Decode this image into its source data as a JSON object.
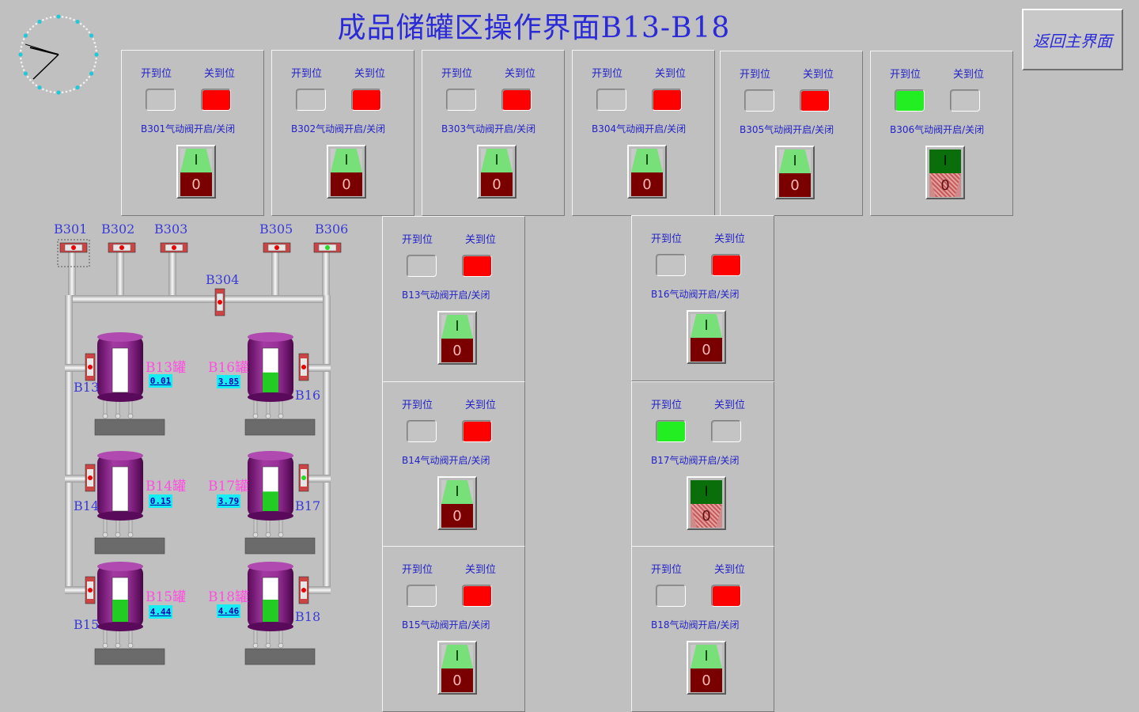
{
  "title": "成品储罐区操作界面B13-B18",
  "home_button": "返回主界面",
  "label_open": "开到位",
  "label_close": "关到位",
  "switch_on_glyph": "I",
  "switch_off_glyph": "0",
  "colors": {
    "lamp_open_on": "#22ee22",
    "lamp_close_on": "#ff0000",
    "text_blue": "#2222c8",
    "tank_label_pink": "#ff4de0",
    "level_box": "#17eef4"
  },
  "valves": [
    {
      "id": "B301",
      "label": "B301气动阀开启/关闭",
      "open": false,
      "closed": true
    },
    {
      "id": "B302",
      "label": "B302气动阀开启/关闭",
      "open": false,
      "closed": true
    },
    {
      "id": "B303",
      "label": "B303气动阀开启/关闭",
      "open": false,
      "closed": true
    },
    {
      "id": "B304",
      "label": "B304气动阀开启/关闭",
      "open": false,
      "closed": true
    },
    {
      "id": "B305",
      "label": "B305气动阀开启/关闭",
      "open": false,
      "closed": true
    },
    {
      "id": "B306",
      "label": "B306气动阀开启/关闭",
      "open": true,
      "closed": false
    },
    {
      "id": "B13",
      "label": "B13气动阀开启/关闭",
      "open": false,
      "closed": true
    },
    {
      "id": "B14",
      "label": "B14气动阀开启/关闭",
      "open": false,
      "closed": true
    },
    {
      "id": "B15",
      "label": "B15气动阀开启/关闭",
      "open": false,
      "closed": true
    },
    {
      "id": "B16",
      "label": "B16气动阀开启/关闭",
      "open": false,
      "closed": true
    },
    {
      "id": "B17",
      "label": "B17气动阀开启/关闭",
      "open": true,
      "closed": false
    },
    {
      "id": "B18",
      "label": "B18气动阀开启/关闭",
      "open": false,
      "closed": true
    }
  ],
  "diagram": {
    "header_valves": [
      "B301",
      "B302",
      "B303",
      "B304",
      "B305",
      "B306"
    ],
    "tanks": [
      {
        "id": "B13",
        "name": "B13罐",
        "valve_label": "B13",
        "level": "0.01",
        "fill": 0.0
      },
      {
        "id": "B14",
        "name": "B14罐",
        "valve_label": "B14",
        "level": "0.15",
        "fill": 0.0
      },
      {
        "id": "B15",
        "name": "B15罐",
        "valve_label": "B15",
        "level": "4.44",
        "fill": 0.5
      },
      {
        "id": "B16",
        "name": "B16罐",
        "valve_label": "B16",
        "level": "3.85",
        "fill": 0.45
      },
      {
        "id": "B17",
        "name": "B17罐",
        "valve_label": "B17",
        "level": "3.79",
        "fill": 0.44
      },
      {
        "id": "B18",
        "name": "B18罐",
        "valve_label": "B18",
        "level": "4.46",
        "fill": 0.5
      }
    ]
  }
}
